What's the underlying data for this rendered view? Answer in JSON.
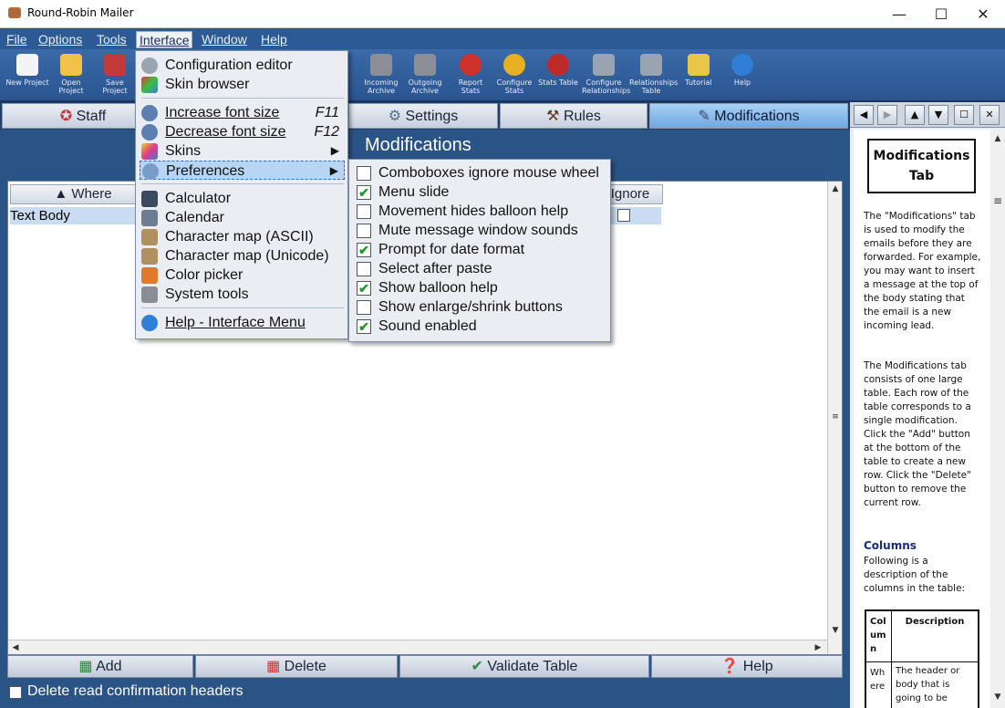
{
  "window": {
    "title": "Round-Robin Mailer",
    "minimize": "—",
    "maximize": "☐",
    "close": "✕"
  },
  "menubar": [
    "File",
    "Options",
    "Tools",
    "Interface",
    "Window",
    "Help"
  ],
  "toolbar": [
    {
      "label": "New Project",
      "icon": "new-project-icon",
      "color": "#f4f4f4"
    },
    {
      "label": "Open Project",
      "icon": "open-project-icon",
      "color": "#f0c24a"
    },
    {
      "label": "Save Project",
      "icon": "save-project-icon",
      "color": "#c03a3a"
    },
    {
      "label": "Incoming Archive",
      "icon": "incoming-archive-icon",
      "color": "#8a8f97"
    },
    {
      "label": "Outgoing Archive",
      "icon": "outgoing-archive-icon",
      "color": "#8a8f97"
    },
    {
      "label": "Report Stats",
      "icon": "report-stats-icon",
      "color": "#d0302a"
    },
    {
      "label": "Configure Stats",
      "icon": "configure-stats-icon",
      "color": "#e6b020"
    },
    {
      "label": "Stats Table",
      "icon": "stats-table-icon",
      "color": "#c02a2a"
    },
    {
      "label": "Configure Relationships",
      "icon": "configure-relationships-icon",
      "color": "#9aa3b0"
    },
    {
      "label": "Relationships Table",
      "icon": "relationships-table-icon",
      "color": "#9aa3b0"
    },
    {
      "label": "Tutorial",
      "icon": "tutorial-icon",
      "color": "#e8c64a"
    },
    {
      "label": "Help",
      "icon": "help-icon",
      "color": "#2f7fd6"
    }
  ],
  "tabs": [
    {
      "label": "Staff",
      "icon": "staff-icon"
    },
    {
      "label": "Settings",
      "icon": "settings-icon"
    },
    {
      "label": "Rules",
      "icon": "rules-icon"
    },
    {
      "label": "Modifications",
      "icon": "modifications-icon"
    }
  ],
  "main": {
    "heading": "Modifications",
    "columns": [
      "Where",
      "Ignore"
    ],
    "rows": [
      {
        "where": "Text Body",
        "ignore": false
      }
    ],
    "buttons": [
      "Add",
      "Delete",
      "Validate Table",
      "Help"
    ],
    "delete_headers_label": "Delete read confirmation headers",
    "delete_headers_checked": false
  },
  "interface_menu": {
    "groups": [
      [
        {
          "label": "Configuration editor",
          "icon": "configuration-editor-icon",
          "color": "#9aa5b2"
        },
        {
          "label": "Skin browser",
          "icon": "skin-browser-icon",
          "color": "#3a9ad8"
        }
      ],
      [
        {
          "label": "Increase font size",
          "icon": "zoom-in-icon",
          "color": "#5a7fb0",
          "shortcut": "F11"
        },
        {
          "label": "Decrease font size",
          "icon": "zoom-out-icon",
          "color": "#5a7fb0",
          "shortcut": "F12"
        },
        {
          "label": "Skins",
          "icon": "skins-icon",
          "color": "#d84aa0",
          "submenu": true
        },
        {
          "label": "Preferences",
          "icon": "preferences-icon",
          "color": "#7a9cc8",
          "submenu": true,
          "highlight": true
        }
      ],
      [
        {
          "label": "Calculator",
          "icon": "calculator-icon",
          "color": "#3c4a5e"
        },
        {
          "label": "Calendar",
          "icon": "calendar-icon",
          "color": "#6d7c90"
        },
        {
          "label": "Character map (ASCII)",
          "icon": "character-map-ascii-icon",
          "color": "#b09060"
        },
        {
          "label": "Character map (Unicode)",
          "icon": "character-map-unicode-icon",
          "color": "#b09060"
        },
        {
          "label": "Color picker",
          "icon": "color-picker-icon",
          "color": "#e07a2a"
        },
        {
          "label": "System tools",
          "icon": "system-tools-icon",
          "color": "#8a8f97"
        }
      ],
      [
        {
          "label": "Help - Interface Menu",
          "icon": "help-icon",
          "color": "#2f7fd6"
        }
      ]
    ]
  },
  "preferences_menu": [
    {
      "label": "Comboboxes ignore mouse wheel",
      "checked": false
    },
    {
      "label": "Menu slide",
      "checked": true
    },
    {
      "label": "Movement hides balloon help",
      "checked": false
    },
    {
      "label": "Mute message window sounds",
      "checked": false
    },
    {
      "label": "Prompt for date format",
      "checked": true
    },
    {
      "label": "Select after paste",
      "checked": false
    },
    {
      "label": "Show balloon help",
      "checked": true
    },
    {
      "label": "Show enlarge/shrink buttons",
      "checked": false
    },
    {
      "label": "Sound enabled",
      "checked": true
    }
  ],
  "help_panel": {
    "title": "Modifications Tab",
    "para1": "The \"Modifications\" tab is used to modify the emails before they are forwarded.  For example, you may want to insert a message at the top of the body stating that the email is a new incoming lead.",
    "para2": "The Modifications tab consists of one large table.  Each row of the table corresponds to a single modification. Click the \"Add\" button at the bottom of the table to create a new row.  Click the \"Delete\" button to remove the current row.",
    "section": "Columns",
    "section_text": "Following is a description of the columns in the table:",
    "table_headers": [
      "Column",
      "Description"
    ],
    "table_row": [
      "Where",
      "The header or body that is going to be"
    ]
  }
}
